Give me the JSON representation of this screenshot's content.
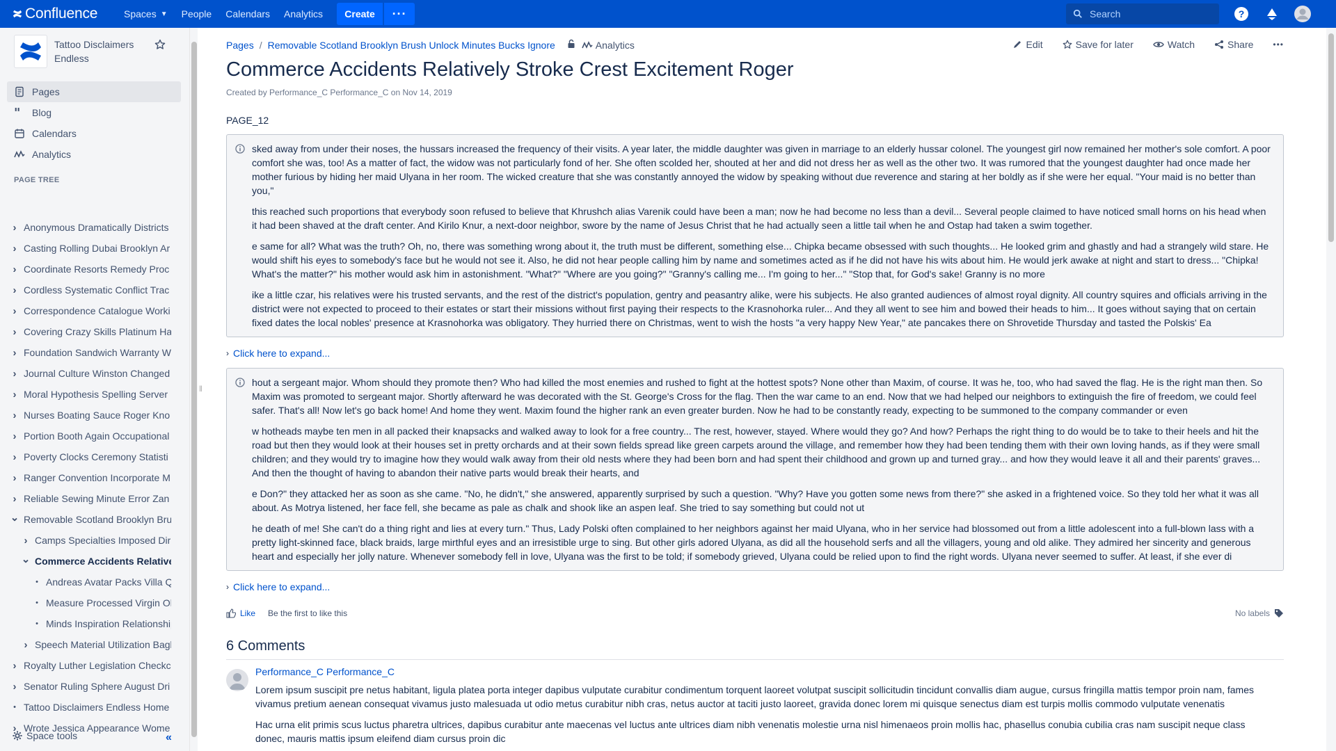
{
  "topnav": {
    "logo_text": "Confluence",
    "items": [
      {
        "label": "Spaces",
        "has_dropdown": true
      },
      {
        "label": "People"
      },
      {
        "label": "Calendars"
      },
      {
        "label": "Analytics"
      }
    ],
    "create_label": "Create",
    "more_label": "···",
    "search_placeholder": "Search",
    "icons": [
      "help-icon",
      "notifications-icon",
      "user-avatar-icon"
    ]
  },
  "sidebar": {
    "space_name": "Tattoo Disclaimers Endless",
    "nav": [
      {
        "label": "Pages",
        "icon": "pages-icon",
        "active": true
      },
      {
        "label": "Blog",
        "icon": "blog-quote-icon"
      },
      {
        "label": "Calendars",
        "icon": "calendar-icon"
      },
      {
        "label": "Analytics",
        "icon": "analytics-icon"
      }
    ],
    "tree_title": "PAGE TREE",
    "tree": [
      {
        "label": "Anonymous Dramatically Districts",
        "level": 0,
        "state": "collapsed"
      },
      {
        "label": "Casting Rolling Dubai Brooklyn Ar",
        "level": 0,
        "state": "collapsed"
      },
      {
        "label": "Coordinate Resorts Remedy Proc",
        "level": 0,
        "state": "collapsed"
      },
      {
        "label": "Cordless Systematic Conflict Trac",
        "level": 0,
        "state": "collapsed"
      },
      {
        "label": "Correspondence Catalogue Worki",
        "level": 0,
        "state": "collapsed"
      },
      {
        "label": "Covering Crazy Skills Platinum Ha",
        "level": 0,
        "state": "collapsed"
      },
      {
        "label": "Foundation Sandwich Warranty W",
        "level": 0,
        "state": "collapsed"
      },
      {
        "label": "Journal Culture Winston Changed",
        "level": 0,
        "state": "collapsed"
      },
      {
        "label": "Moral Hypothesis Spelling Server",
        "level": 0,
        "state": "collapsed"
      },
      {
        "label": "Nurses Boating Sauce Roger Kno",
        "level": 0,
        "state": "collapsed"
      },
      {
        "label": "Portion Booth Again Occupational",
        "level": 0,
        "state": "collapsed"
      },
      {
        "label": "Poverty Clocks Ceremony Statisti",
        "level": 0,
        "state": "collapsed"
      },
      {
        "label": "Ranger Convention Incorporate M",
        "level": 0,
        "state": "collapsed"
      },
      {
        "label": "Reliable Sewing Minute Error Zan",
        "level": 0,
        "state": "collapsed"
      },
      {
        "label": "Removable Scotland Brooklyn Bru",
        "level": 0,
        "state": "expanded"
      },
      {
        "label": "Camps Specialties Imposed Dir",
        "level": 1,
        "state": "collapsed"
      },
      {
        "label": "Commerce Accidents Relative",
        "level": 1,
        "state": "expanded",
        "current": true
      },
      {
        "label": "Andreas Avatar Packs Villa Q",
        "level": 2,
        "state": "leaf"
      },
      {
        "label": "Measure Processed Virgin Ol",
        "level": 2,
        "state": "leaf"
      },
      {
        "label": "Minds Inspiration Relationship",
        "level": 2,
        "state": "leaf"
      },
      {
        "label": "Speech Material Utilization Bagl",
        "level": 1,
        "state": "collapsed"
      },
      {
        "label": "Royalty Luther Legislation Checkc",
        "level": 0,
        "state": "collapsed"
      },
      {
        "label": "Senator Ruling Sphere August Dri",
        "level": 0,
        "state": "collapsed"
      },
      {
        "label": "Tattoo Disclaimers Endless Home",
        "level": 0,
        "state": "leaf"
      },
      {
        "label": "Wrote Jessica Appearance Wome",
        "level": 0,
        "state": "collapsed"
      }
    ],
    "space_tools": "Space tools",
    "collapse_label": "«"
  },
  "main": {
    "breadcrumb": [
      "Pages",
      "Removable Scotland Brooklyn Brush Unlock Minutes Bucks Ignore"
    ],
    "breadcrumb_sep": "/",
    "analytics_label": "Analytics",
    "actions": [
      {
        "label": "Edit",
        "icon": "pencil-icon"
      },
      {
        "label": "Save for later",
        "icon": "star-icon"
      },
      {
        "label": "Watch",
        "icon": "eye-icon"
      },
      {
        "label": "Share",
        "icon": "share-icon"
      }
    ],
    "more_actions": "•••",
    "title": "Commerce Accidents Relatively Stroke Crest Excitement Roger",
    "byline": "Created by Performance_C Performance_C on Nov 14, 2019",
    "page_label": "PAGE_12",
    "panel1": [
      "sked away from under their noses, the hussars increased the frequency of their visits. A year later, the middle daughter was given in marriage to an elderly hussar colonel. The youngest girl now remained her mother's sole comfort. A poor comfort she was, too! As a matter of fact, the widow was not particularly fond of her. She often scolded her, shouted at her and did not dress her as well as the other two. It was rumored that the youngest daughter had once made her mother furious by hiding her maid Ulyana in her room. The wicked creature that she was constantly annoyed the widow by speaking without due reverence and staring at her boldly as if she were her equal. \"Your maid is no better than you,\"",
      "this reached such proportions that everybody soon refused to believe that Khrushch alias Varenik could have been a man; now he had become no less than a devil... Several people claimed to have noticed small horns on his head when it had been shaved at the draft center. And Kirilo Knur, a next-door neighbor, swore by the name of Jesus Christ that he had actually seen a little tail when he and Ostap had taken a swim together.",
      "e same for all? What was the truth? Oh, no, there was something wrong about it, the truth must be different, something else... Chipka became obsessed with such thoughts... He looked grim and ghastly and had a strangely wild stare. He would shift his eyes to somebody's face but he would not see it. Also, he did not hear people calling him by name and sometimes acted as if he did not have his wits about him. He would jerk awake at night and start to dress... \"Chipka! What's the matter?\" his mother would ask him in astonishment. \"What?\" \"Where are you going?\" \"Granny's calling me... I'm going to her...\" \"Stop that, for God's sake! Granny is no more",
      "ike a little czar, his relatives were his trusted servants, and the rest of the district's population, gentry and peasantry alike, were his subjects. He also granted audiences of almost royal dignity. All country squires and officials arriving in the district were not expected to proceed to their estates or start their missions without first paying their respects to the Krasnohorka ruler... And they all went to see him and bowed their heads to him... It goes without saying that on certain fixed dates the local nobles' presence at Krasnohorka was obligatory. They hurried there on Christmas, went to wish the hosts \"a very happy New Year,\" ate pancakes there on Shrovetide Thursday and tasted the Polskis' Ea"
    ],
    "expand1": "Click here to expand...",
    "panel2": [
      "hout a sergeant major. Whom should they promote then? Who had killed the most enemies and rushed to fight at the hottest spots? None other than Maxim, of course. It was he, too, who had saved the flag. He is the right man then. So Maxim was promoted to sergeant major. Shortly afterward he was decorated with the St. George's Cross for the flag. Then the war came to an end. Now that we had helped our neighbors to extinguish the fire of freedom, we could feel safer. That's all! Now let's go back home! And home they went. Maxim found the higher rank an even greater burden. Now he had to be constantly ready, expecting to be summoned to the company commander or even",
      "w hotheads maybe ten men in all packed their knapsacks and walked away to look for a free country... The rest, however, stayed. Where would they go? And how? Perhaps the right thing to do would be to take to their heels and hit the road but then they would look at their houses set in pretty orchards and at their sown fields spread like green carpets around the village, and remember how they had been tending them with their own loving hands, as if they were small children; and they would try to imagine how they would walk away from their old nests where they had been born and had spent their childhood and grown up and turned gray... and how they would leave it all and their parents' graves... And then the thought of having to abandon their native parts would break their hearts, and",
      "e Don?\" they attacked her as soon as she came. \"No, he didn't,\" she answered, apparently surprised by such a question. \"Why? Have you gotten some news from there?\" she asked in a frightened voice. So they told her what it was all about. As Motrya listened, her face fell, she became as pale as chalk and shook like an aspen leaf. She tried to say something but could not ut",
      "he death of me! She can't do a thing right and lies at every turn.\" Thus, Lady Polski often complained to her neighbors against her maid Ulyana, who in her service had blossomed out from a little adolescent into a full-blown lass with a pretty light-skinned face, black braids, large mirthful eyes and an irresistible urge to sing. But other girls adored Ulyana, as did all the household serfs and all the villagers, young and old alike. They admired her sincerity and generous heart and especially her jolly nature. Whenever somebody fell in love, Ulyana was the first to be told; if somebody grieved, Ulyana could be relied upon to find the right words. Ulyana never seemed to suffer. At least, if she ever di"
    ],
    "expand2": "Click here to expand...",
    "like_label": "Like",
    "like_first": "Be the first to like this",
    "labels_text": "No labels",
    "comments_title": "6 Comments",
    "comment": {
      "author": "Performance_C Performance_C",
      "paragraphs": [
        "Lorem ipsum suscipit pre netus habitant, ligula platea porta integer dapibus vulputate curabitur condimentum torquent laoreet volutpat suscipit sollicitudin tincidunt convallis diam augue, cursus fringilla mattis tempor proin nam, fames vivamus pretium aenean consequat vivamus justo malesuada ut odio metus curabitur nibh cras, netus auctor at taciti justo laoreet, gravida donec lorem mi quisque senectus diam est turpis mollis commodo vulputate venenatis",
        "Hac urna elit primis scus luctus pharetra ultrices, dapibus curabitur ante maecenas vel luctus ante ultrices diam nibh venenatis molestie urna nisl himenaeos proin mollis hac, phasellus conubia cubilia cras nam suscipit neque class donec, mauris mattis ipsum eleifend diam cursus proin dic"
      ]
    }
  },
  "colors": {
    "topnav": "#0052cc",
    "link": "#0052cc",
    "sidebar_bg": "#f4f5f7",
    "panel_bg": "#f4f5f7"
  }
}
